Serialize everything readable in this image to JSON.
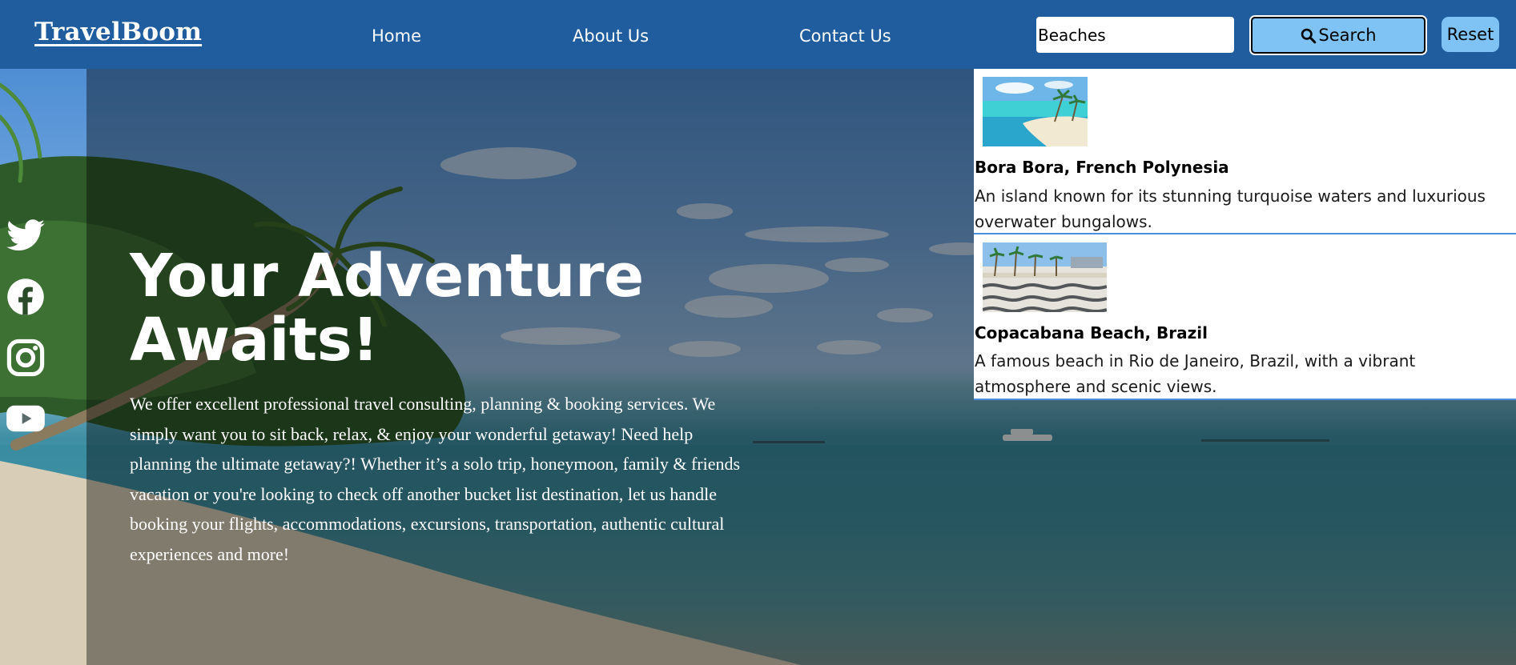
{
  "navbar": {
    "brand": "TravelBoom",
    "links": [
      {
        "label": "Home"
      },
      {
        "label": "About Us"
      },
      {
        "label": "Contact Us"
      }
    ],
    "search": {
      "value": "Beaches",
      "button_label": "Search",
      "reset_label": "Reset"
    }
  },
  "hero": {
    "title": "Your Adventure Awaits!",
    "text": "We offer excellent professional travel consulting, planning & booking services. We simply want you to sit back, relax, & enjoy your wonderful getaway! Need help planning the ultimate getaway?! Whether it’s a solo trip, honeymoon, family & friends vacation or you're looking to check off another bucket list destination, let us handle booking your flights, accommodations, excursions, transportation, authentic cultural experiences and more!"
  },
  "social": [
    {
      "icon": "twitter-icon"
    },
    {
      "icon": "facebook-icon"
    },
    {
      "icon": "instagram-icon"
    },
    {
      "icon": "youtube-icon"
    }
  ],
  "results": [
    {
      "name": "Bora Bora, French Polynesia",
      "description": "An island known for its stunning turquoise waters and luxurious overwater bungalows."
    },
    {
      "name": "Copacabana Beach, Brazil",
      "description": "A famous beach in Rio de Janeiro, Brazil, with a vibrant atmosphere and scenic views."
    }
  ],
  "colors": {
    "navbar": "#1f5d9e",
    "button": "#7ec3f4",
    "result_border": "#4a8fe0"
  }
}
